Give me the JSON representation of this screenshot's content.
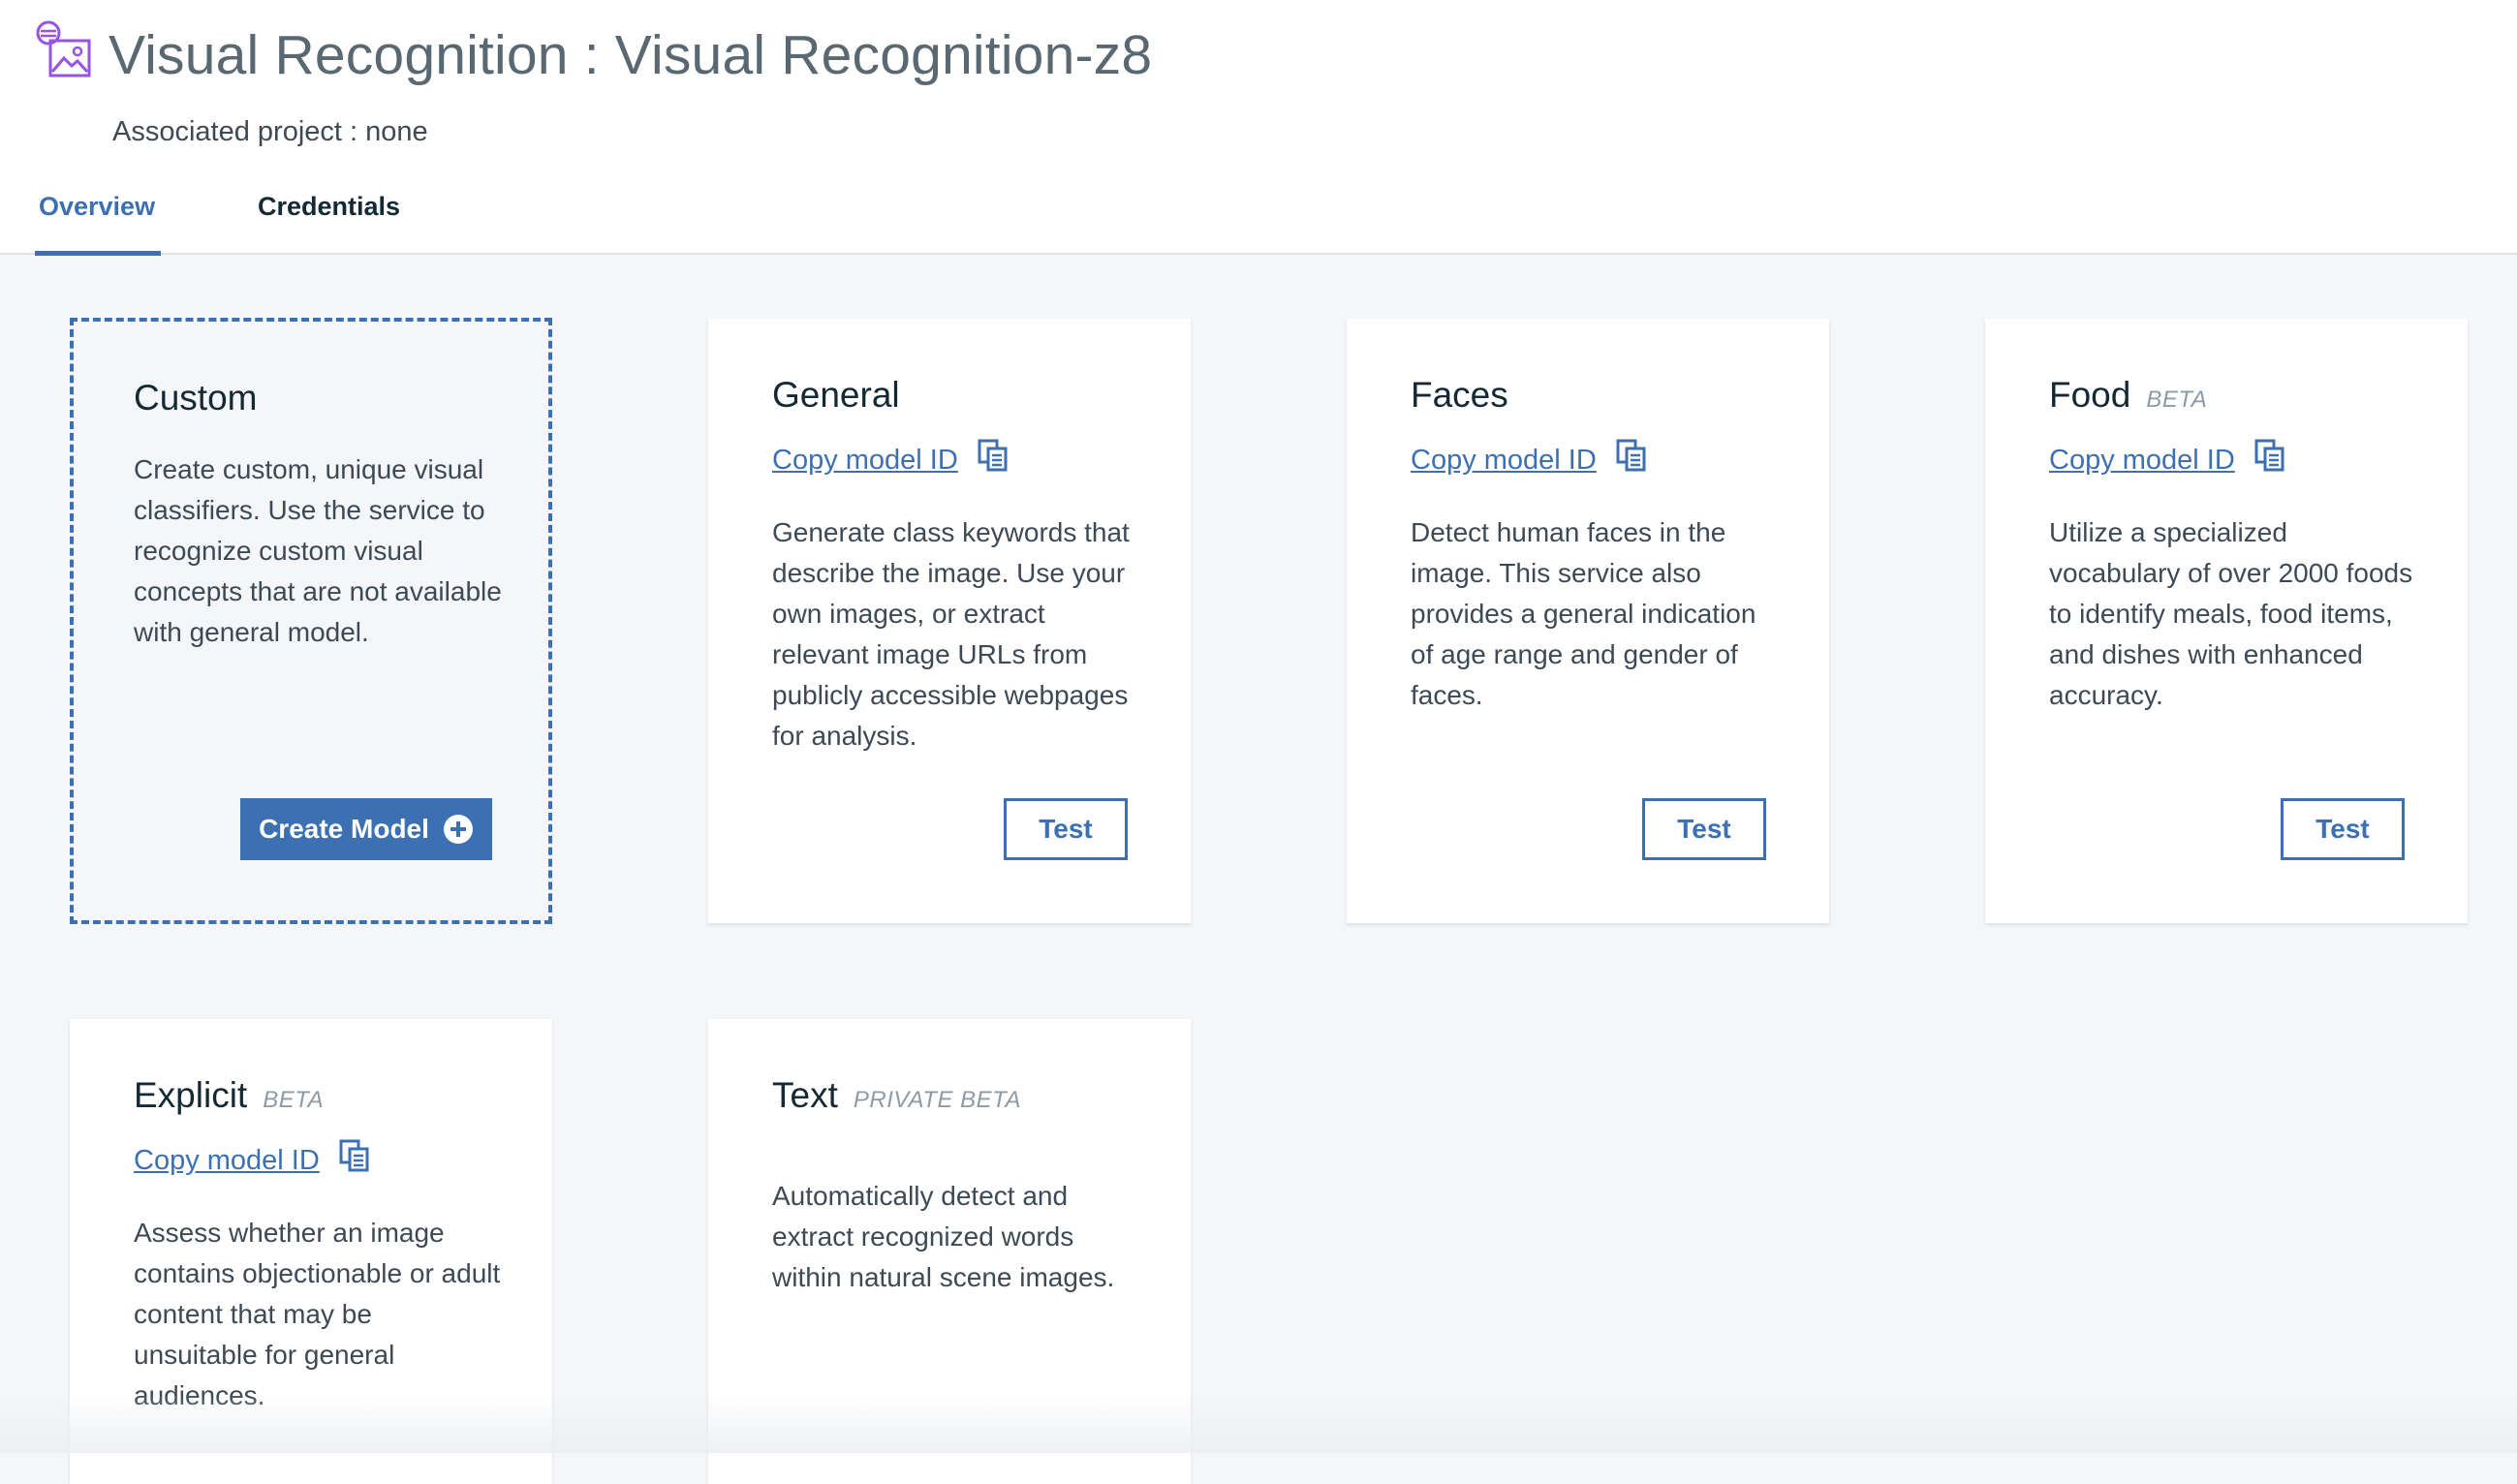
{
  "header": {
    "title": "Visual Recognition : Visual Recognition-z8",
    "associated_project": "Associated project : none"
  },
  "tabs": [
    {
      "label": "Overview",
      "active": true
    },
    {
      "label": "Credentials",
      "active": false
    }
  ],
  "copy_model_label": "Copy model ID",
  "test_label": "Test",
  "cards": {
    "custom": {
      "title": "Custom",
      "description": "Create custom, unique visual classifiers. Use the service to recognize custom visual concepts that are not available with general model.",
      "button_label": "Create Model"
    },
    "general": {
      "title": "General",
      "description": "Generate class keywords that describe the image. Use your own images, or extract relevant image URLs from publicly accessible webpages for analysis."
    },
    "faces": {
      "title": "Faces",
      "description": "Detect human faces in the image. This service also provides a general indication of age range and gender of faces."
    },
    "food": {
      "title": "Food",
      "badge": "BETA",
      "description": "Utilize a specialized vocabulary of over 2000 foods to identify meals, food items, and dishes with enhanced accuracy."
    },
    "explicit": {
      "title": "Explicit",
      "badge": "BETA",
      "description": "Assess whether an image contains objectionable or adult content that may be unsuitable for general audiences."
    },
    "text": {
      "title": "Text",
      "badge": "PRIVATE BETA",
      "description": "Automatically detect and extract recognized words within natural scene images."
    }
  },
  "icons": {
    "title": "visual-recognition-icon",
    "copy": "copy-icon",
    "create": "plus-circle-icon"
  },
  "colors": {
    "accent": "#3d70b2",
    "title_icon": "#9753e1",
    "background": "#f4f6f9"
  }
}
